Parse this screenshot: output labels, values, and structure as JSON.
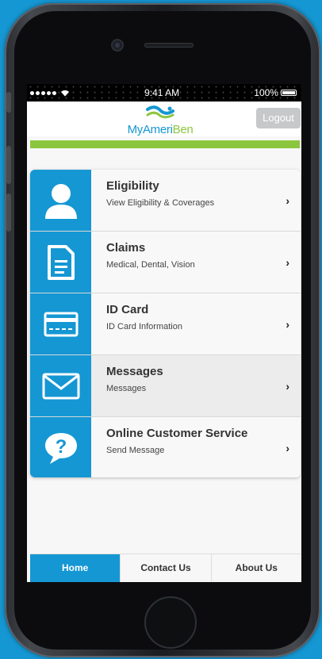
{
  "status_bar": {
    "time": "9:41 AM",
    "battery": "100%"
  },
  "header": {
    "logo_my": "My",
    "logo_ameri": "Ameri",
    "logo_ben": "Ben",
    "logout_label": "Logout"
  },
  "colors": {
    "brand_blue": "#1597d3",
    "brand_green": "#8cc63f",
    "logout_gray": "#c6c8ca"
  },
  "menu": {
    "items": [
      {
        "title": "Eligibility",
        "subtitle": "View Eligibility & Coverages",
        "icon": "person-icon"
      },
      {
        "title": "Claims",
        "subtitle": "Medical, Dental, Vision",
        "icon": "document-icon"
      },
      {
        "title": "ID Card",
        "subtitle": "ID Card Information",
        "icon": "id-card-icon"
      },
      {
        "title": "Messages",
        "subtitle": "Messages",
        "icon": "envelope-icon"
      },
      {
        "title": "Online Customer Service",
        "subtitle": "Send Message",
        "icon": "question-bubble-icon"
      }
    ]
  },
  "tabs": [
    {
      "label": "Home",
      "active": true
    },
    {
      "label": "Contact Us",
      "active": false
    },
    {
      "label": "About Us",
      "active": false
    }
  ]
}
